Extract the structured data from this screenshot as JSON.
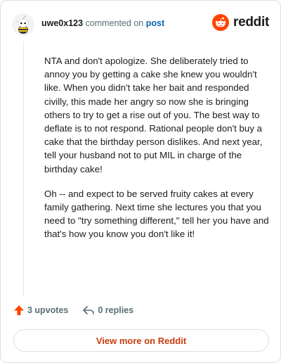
{
  "header": {
    "username": "uwe0x123",
    "action_text": "commented on",
    "post_link": "post",
    "brand": "reddit",
    "avatar_icon": "snoo-avatar-icon"
  },
  "comment": {
    "paragraphs": [
      "NTA and don't apologize. She deliberately tried to annoy you by getting a cake she knew you wouldn't like. When you didn't take her bait and responded civilly, this made her angry so now she is bringing others to try to get a rise out of you. The best way to deflate is to not respond. Rational people don't buy a cake that the birthday person dislikes. And next year, tell your husband not to put MIL in charge of the birthday cake!",
      "Oh -- and expect to be served fruity cakes at every family gathering. Next time she lectures you that you need to \"try something different,\" tell her you have and that's how you know you don't like it!"
    ]
  },
  "actions": {
    "upvotes": "3 upvotes",
    "replies": "0 replies"
  },
  "footer": {
    "view_more": "View more on Reddit"
  },
  "colors": {
    "accent": "#ff4500",
    "link": "#0a66b3",
    "view_more": "#c93c0e"
  }
}
